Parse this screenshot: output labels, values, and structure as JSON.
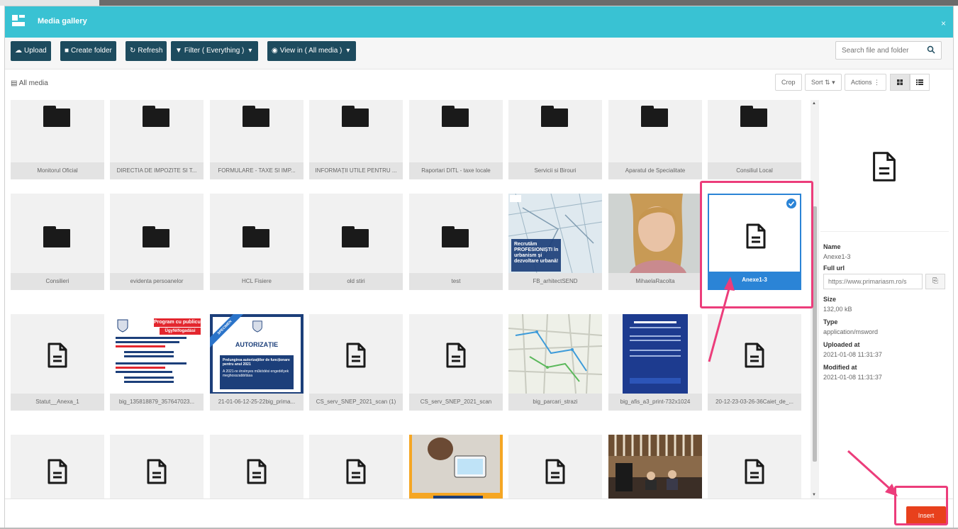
{
  "window": {
    "title": "Media gallery",
    "close": "×"
  },
  "toolbar": {
    "upload": "Upload",
    "create_folder": "Create folder",
    "refresh": "Refresh",
    "filter": "Filter ( Everything )",
    "view_in": "View in ( All media )",
    "search_placeholder": "Search file and folder"
  },
  "breadcrumb": {
    "label": "All media"
  },
  "actionbar": {
    "crop": "Crop",
    "sort": "Sort",
    "actions": "Actions"
  },
  "colors": {
    "titlebar": "#39c2d3",
    "toolbar_button": "#1d4b5e",
    "selected": "#2b84d6",
    "insert": "#e8401c",
    "highlight": "#ec3d7b"
  },
  "items": {
    "r0": [
      "Monitorul Oficial",
      "DIRECTIA DE IMPOZITE SI T...",
      "FORMULARE - TAXE SI IMP...",
      "INFORMAȚII UTILE PENTRU ...",
      "Raportari DITL - taxe locale",
      "Servicii si Birouri",
      "Aparatul de Specialitate",
      "Consiliul Local"
    ],
    "r1": [
      "Consilieri",
      "evidenta persoanelor",
      "HCL Fisiere",
      "old stiri",
      "test",
      "FB_arhitectSEND",
      "MihaelaRacolta",
      "Anexe1-3"
    ],
    "r2": [
      "Statut__Anexa_1",
      "big_135818879_357647023...",
      "21-01-06-12-25-22big_prima...",
      "CS_serv_SNEP_2021_scan (1)",
      "CS_serv_SNEP_2021_scan",
      "big_parcari_strazi",
      "big_afis_a3_print-732x1024",
      "20-12-23-03-26-36Caiet_de_..."
    ]
  },
  "thumb_text": {
    "recruit": "Recrutăm PROFESIONIȘTI în urbanism și dezvoltare urbană!",
    "program_title": "Program cu publicul",
    "program_sub": "Ügyfélfogadási",
    "autorizatie": "AUTORIZAȚIE",
    "specimen": "SPECIMEN",
    "autorizatie_sub": "Prelungirea autorizațiilor de funcționare pentru anul 2021",
    "autorizatie_hu": "A 2021-re érvényes működési engedélyek meghosszabbítása"
  },
  "detail": {
    "name_label": "Name",
    "name_value": "Anexe1-3",
    "url_label": "Full url",
    "url_value": "https://www.primariasm.ro/s",
    "size_label": "Size",
    "size_value": "132,00 kB",
    "type_label": "Type",
    "type_value": "application/msword",
    "uploaded_label": "Uploaded at",
    "uploaded_value": "2021-01-08 11:31:37",
    "modified_label": "Modified at",
    "modified_value": "2021-01-08 11:31:37"
  },
  "footer": {
    "insert": "Insert"
  }
}
